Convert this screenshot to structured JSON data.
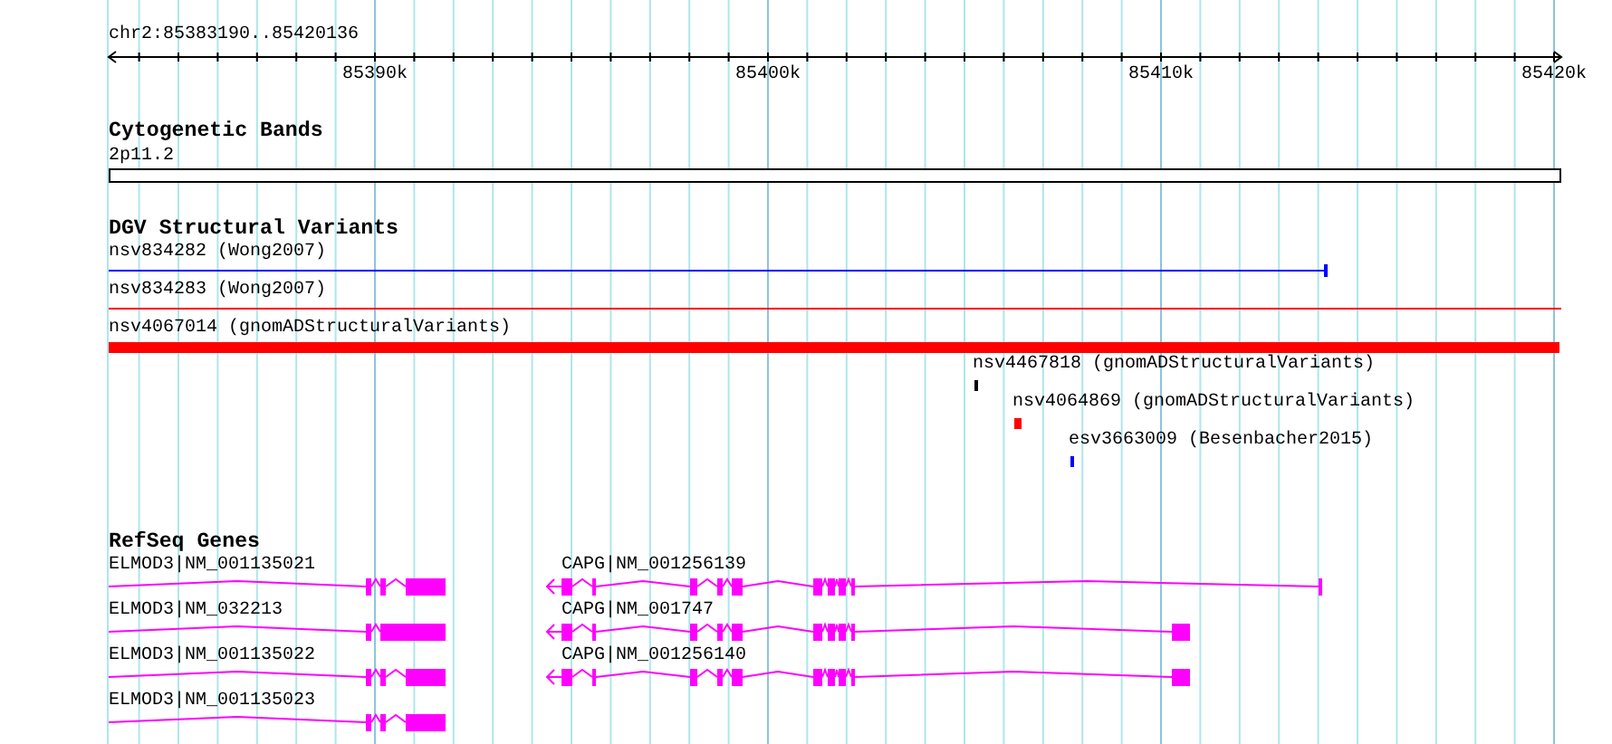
{
  "ruler": {
    "label": "chr2:85383190..85420136",
    "ticks": [
      "85390k",
      "85400k",
      "85410k",
      "85420k"
    ]
  },
  "tracks": [
    {
      "title": "Cytogenetic Bands",
      "features": [
        {
          "label": "2p11.2",
          "kind": "band"
        }
      ]
    },
    {
      "title": "DGV Structural Variants",
      "features": [
        {
          "label": "nsv834282 (Wong2007)",
          "kind": "line",
          "color": "#0000ff"
        },
        {
          "label": "nsv834283 (Wong2007)",
          "kind": "line",
          "color": "#ff0000"
        },
        {
          "label": "nsv4067014 (gnomADStructuralVariants)",
          "kind": "bar",
          "color": "#ff0000"
        },
        {
          "label": "nsv4467818 (gnomADStructuralVariants)",
          "kind": "mark",
          "color": "#000000"
        },
        {
          "label": "nsv4064869 (gnomADStructuralVariants)",
          "kind": "mark",
          "color": "#ff0000"
        },
        {
          "label": "esv3663009 (Besenbacher2015)",
          "kind": "mark",
          "color": "#0000ff"
        }
      ]
    },
    {
      "title": "RefSeq Genes",
      "features": [
        {
          "label": "ELMOD3|NM_001135021",
          "kind": "gene"
        },
        {
          "label": "CAPG|NM_001256139",
          "kind": "gene"
        },
        {
          "label": "ELMOD3|NM_032213",
          "kind": "gene"
        },
        {
          "label": "CAPG|NM_001747",
          "kind": "gene"
        },
        {
          "label": "ELMOD3|NM_001135022",
          "kind": "gene"
        },
        {
          "label": "CAPG|NM_001256140",
          "kind": "gene"
        },
        {
          "label": "ELMOD3|NM_001135023",
          "kind": "gene"
        }
      ]
    }
  ]
}
